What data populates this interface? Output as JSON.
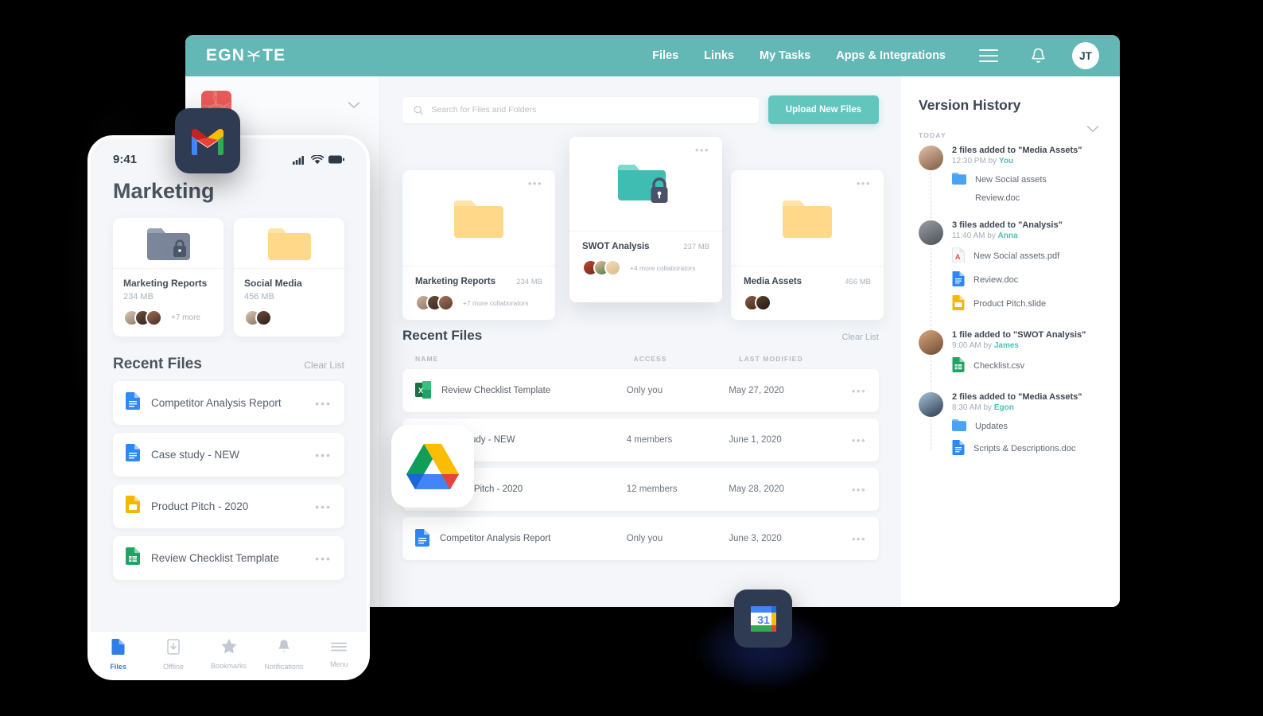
{
  "brand": {
    "name": "EGNYTE",
    "teal": "#63b8b5",
    "accent": "#63c6bd"
  },
  "desktop": {
    "nav": {
      "items": [
        "Files",
        "Links",
        "My Tasks",
        "Apps & Integrations"
      ],
      "avatar_initials": "JT"
    },
    "search": {
      "placeholder": "Search for Files and Folders",
      "value": ""
    },
    "upload_button": "Upload New Files",
    "folder_cards": [
      {
        "name": "Marketing Reports",
        "size": "234 MB",
        "collaborators": "+7 more collaborators",
        "icon": "folder-yellow-icon"
      },
      {
        "name": "SWOT Analysis",
        "size": "237 MB",
        "collaborators": "+4 more collaborators",
        "icon": "folder-teal-locked-icon"
      },
      {
        "name": "Media Assets",
        "size": "456 MB",
        "collaborators": "",
        "icon": "folder-yellow-icon"
      }
    ],
    "recent": {
      "title": "Recent Files",
      "clear_label": "Clear List",
      "columns": [
        "NAME",
        "ACCESS",
        "LAST MODIFIED"
      ],
      "rows": [
        {
          "name": "Review Checklist Template",
          "access": "Only you",
          "modified": "May 27, 2020",
          "icon": "excel-file-icon"
        },
        {
          "name": "Case study - NEW",
          "access": "4 members",
          "modified": "June 1, 2020",
          "icon": "gdoc-file-icon"
        },
        {
          "name": "Product Pitch - 2020",
          "access": "12 members",
          "modified": "May 28, 2020",
          "icon": "gslides-file-icon"
        },
        {
          "name": "Competitor Analysis Report",
          "access": "Only you",
          "modified": "June 3, 2020",
          "icon": "gdoc-file-icon"
        }
      ]
    },
    "version_history": {
      "title": "Version History",
      "section_label": "TODAY",
      "entries": [
        {
          "headline": "2 files added to \"Media Assets\"",
          "time": "12:30 PM",
          "by_prefix": "by",
          "user": "You",
          "files": [
            {
              "name": "New Social assets",
              "icon": "folder-blue-icon"
            },
            {
              "name": "Review.doc",
              "icon": "blank-icon"
            }
          ]
        },
        {
          "headline": "3 files added to \"Analysis\"",
          "time": "11:40 AM",
          "by_prefix": "by",
          "user": "Anna",
          "files": [
            {
              "name": "New Social assets.pdf",
              "icon": "pdf-file-icon"
            },
            {
              "name": "Review.doc",
              "icon": "gdoc-file-icon"
            },
            {
              "name": "Product Pitch.slide",
              "icon": "gslides-file-icon"
            }
          ]
        },
        {
          "headline": "1 file added to \"SWOT Analysis\"",
          "time": "9:00 AM",
          "by_prefix": "by",
          "user": "James",
          "files": [
            {
              "name": "Checklist.csv",
              "icon": "gsheet-file-icon"
            }
          ]
        },
        {
          "headline": "2 files added to \"Media Assets\"",
          "time": "8:30 AM",
          "by_prefix": "by",
          "user": "Egon",
          "files": [
            {
              "name": "Updates",
              "icon": "folder-blue-icon"
            },
            {
              "name": "Scripts & Descriptions.doc",
              "icon": "gdoc-file-icon"
            }
          ]
        }
      ]
    }
  },
  "phone": {
    "status_time": "9:41",
    "title": "Marketing",
    "folder_cards": [
      {
        "name": "Marketing Reports",
        "size": "234 MB",
        "more": "+7 more",
        "icon": "folder-dark-locked-icon"
      },
      {
        "name": "Social Media",
        "size": "456 MB",
        "more": "",
        "icon": "folder-yellow-icon"
      }
    ],
    "recent": {
      "title": "Recent Files",
      "clear_label": "Clear List",
      "rows": [
        {
          "name": "Competitor Analysis Report",
          "icon": "gdoc-file-icon"
        },
        {
          "name": "Case study - NEW",
          "icon": "gdoc-file-icon"
        },
        {
          "name": "Product Pitch - 2020",
          "icon": "gslides-file-icon"
        },
        {
          "name": "Review Checklist Template",
          "icon": "gsheet-file-icon"
        }
      ]
    },
    "tabs": [
      {
        "label": "Files",
        "icon": "file-icon",
        "active": true
      },
      {
        "label": "Offline",
        "icon": "offline-download-icon",
        "active": false
      },
      {
        "label": "Bookmarks",
        "icon": "star-icon",
        "active": false
      },
      {
        "label": "Notifications",
        "icon": "bell-icon",
        "active": false
      },
      {
        "label": "Menu",
        "icon": "hamburger-icon",
        "active": false
      }
    ]
  },
  "floating_icons": [
    {
      "name": "gmail-icon"
    },
    {
      "name": "google-drive-icon"
    },
    {
      "name": "google-calendar-icon",
      "day": "31"
    }
  ]
}
